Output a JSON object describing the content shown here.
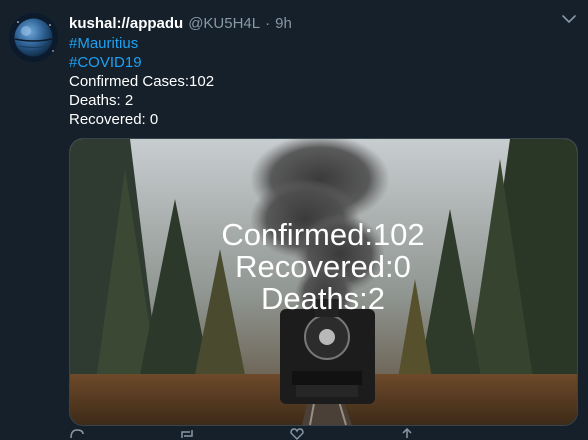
{
  "tweet": {
    "display_name": "kushal://appadu",
    "handle": "@KU5H4L",
    "separator": "·",
    "time": "9h",
    "hashtags": [
      "#Mauritius",
      "#COVID19"
    ],
    "lines": [
      "Confirmed Cases:102",
      "Deaths: 2",
      "Recovered: 0"
    ]
  },
  "media": {
    "overlay_lines": [
      "Confirmed:102",
      "Recovered:0",
      "Deaths:2"
    ]
  },
  "colors": {
    "background": "#15202b",
    "hashtag": "#1da1f2",
    "secondary_text": "#8899a6"
  },
  "icons": {
    "menu": "chevron-down-icon",
    "avatar": "death-star-avatar",
    "actions": [
      "reply-icon",
      "retweet-icon",
      "like-icon",
      "share-icon"
    ]
  }
}
